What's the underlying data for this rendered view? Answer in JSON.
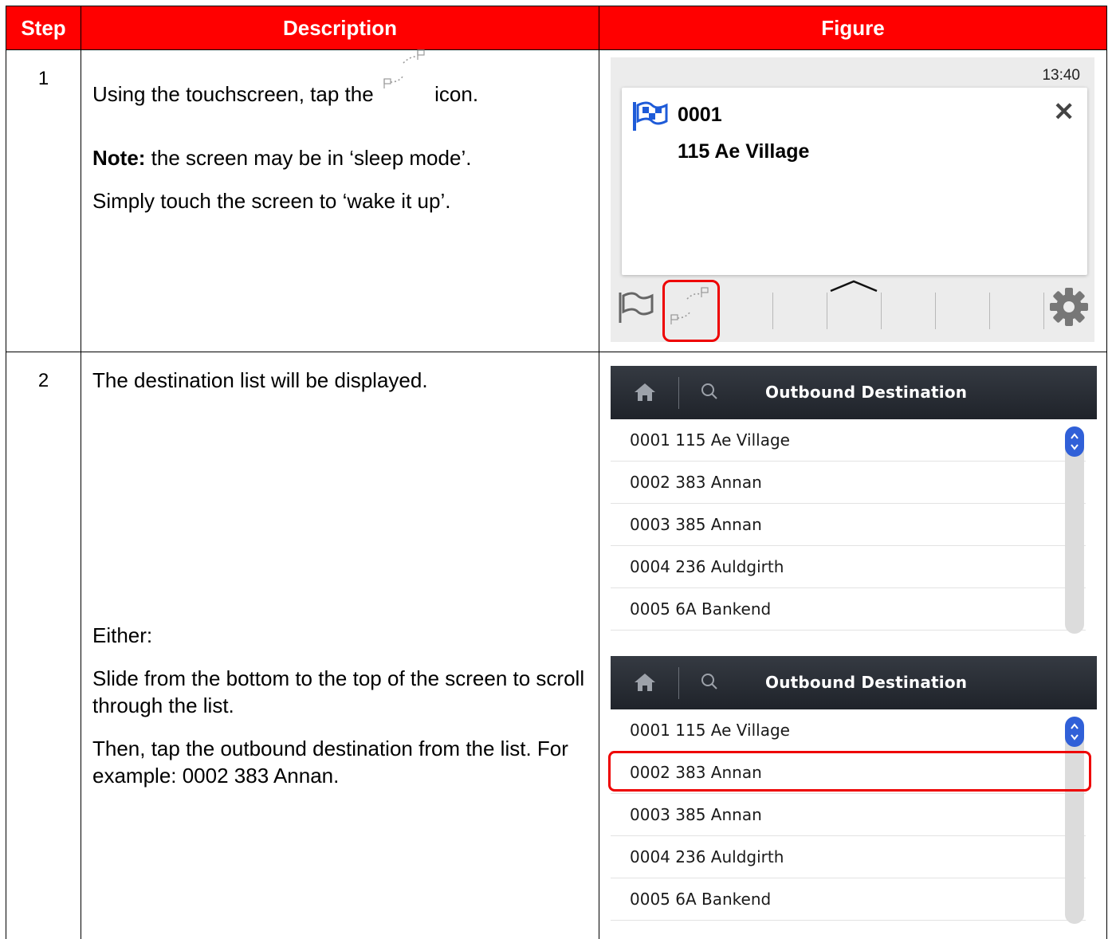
{
  "table": {
    "headers": [
      "Step",
      "Description",
      "Figure"
    ]
  },
  "step1": {
    "num": "1",
    "instruction_pre": "Using the touchscreen, tap the",
    "instruction_post": "icon.",
    "note_label": "Note:",
    "note_text": "the screen may be in ‘sleep mode’.",
    "wake": "Simply touch the screen to ‘wake it up’.",
    "figure": {
      "time": "13:40",
      "code": "0001",
      "name": "115 Ae Village",
      "close": "✕"
    }
  },
  "step2": {
    "num": "2",
    "line1": "The destination list will be displayed.",
    "either": "Either:",
    "slide": "Slide from the bottom to the top of the screen to scroll through the list.",
    "tap": "Then, tap the outbound destination from the list. For example: 0002 383 Annan.",
    "screen_title": "Outbound Destination",
    "items": [
      "0001 115 Ae Village",
      "0002 383 Annan",
      "0003 385 Annan",
      "0004 236 Auldgirth",
      "0005 6A Bankend"
    ]
  },
  "colors": {
    "header_bg": "#ff0000",
    "highlight": "#ee0000",
    "scroll_thumb": "#3060d8"
  }
}
